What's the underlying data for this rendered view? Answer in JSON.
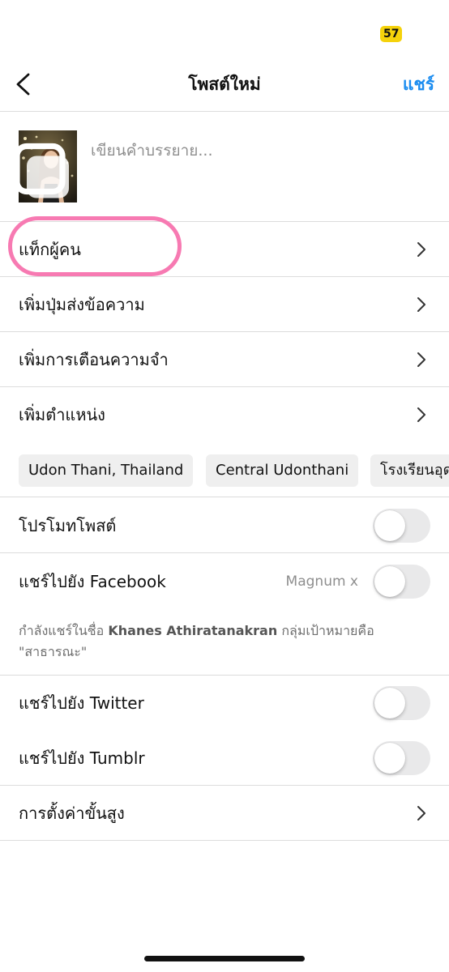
{
  "status_bar": {
    "battery": "57"
  },
  "header": {
    "title": "โพสต์ใหม่",
    "share_label": "แชร์"
  },
  "caption": {
    "placeholder": "เขียนคำบรรยาย..."
  },
  "menu": {
    "tag_people": "แท็กผู้คน",
    "add_message_button": "เพิ่มปุ่มส่งข้อความ",
    "add_reminder": "เพิ่มการเตือนความจำ",
    "add_location": "เพิ่มตำแหน่ง"
  },
  "location_suggestions": [
    "Udon Thani, Thailand",
    "Central Udonthani",
    "โรงเรียนอุด"
  ],
  "toggles": {
    "promote_post": "โปรโมทโพสต์",
    "share_facebook": "แชร์ไปยัง Facebook",
    "facebook_account": "Magnum x",
    "share_twitter": "แชร์ไปยัง Twitter",
    "share_tumblr": "แชร์ไปยัง Tumblr"
  },
  "share_note": {
    "prefix": "กำลังแชร์ในชื่อ ",
    "name": "Khanes Athiratanakran",
    "suffix": " กลุ่มเป้าหมายคือ \"สาธารณะ\""
  },
  "advanced_settings": "การตั้งค่าขั้นสูง",
  "colors": {
    "accent": "#1a8cf0",
    "highlight": "#f77ab2",
    "badge": "#f5d20b"
  }
}
